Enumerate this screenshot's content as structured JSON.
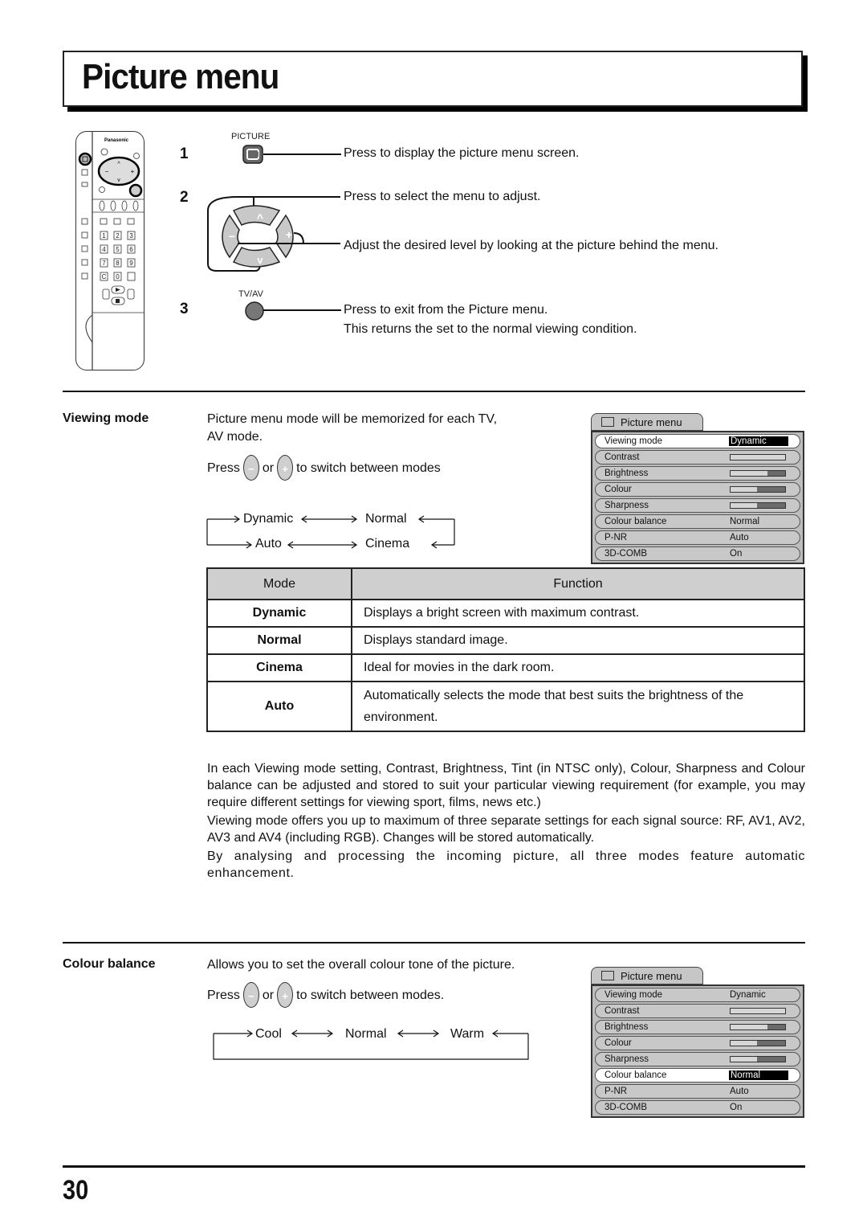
{
  "page": {
    "title": "Picture menu",
    "page_number": "30"
  },
  "remote": {
    "brand": "Panasonic",
    "numpad": [
      "1",
      "2",
      "3",
      "4",
      "5",
      "6",
      "7",
      "8",
      "9",
      "C",
      "0",
      "-/--"
    ]
  },
  "steps": [
    {
      "number": "1",
      "button_label": "PICTURE",
      "button_icon": "picture-button-icon",
      "lines": [
        "Press to display the picture menu screen."
      ]
    },
    {
      "number": "2",
      "button_label": "",
      "button_icon": "cursor-pad-icon",
      "lines": [
        "Press to select the menu to adjust.",
        "Adjust the desired level by looking at the picture behind the menu."
      ]
    },
    {
      "number": "3",
      "button_label": "TV/AV",
      "button_icon": "tv-av-button-icon",
      "lines": [
        "Press to exit from the Picture menu.",
        "This returns the set to the normal viewing condition."
      ]
    }
  ],
  "viewing_mode": {
    "label": "Viewing mode",
    "intro_line1": "Picture menu mode will be memorized for each TV,",
    "intro_line2": "AV mode.",
    "press": "Press",
    "or": "or",
    "switch_text": "to switch between modes",
    "minus_glyph": "−",
    "plus_glyph": "+",
    "cycle": {
      "top_left": "Dynamic",
      "top_right": "Normal",
      "bottom_left": "Auto",
      "bottom_right": "Cinema"
    },
    "table": {
      "headers": [
        "Mode",
        "Function"
      ],
      "rows": [
        {
          "mode": "Dynamic",
          "function": "Displays a bright screen with maximum contrast."
        },
        {
          "mode": "Normal",
          "function": "Displays standard image."
        },
        {
          "mode": "Cinema",
          "function": "Ideal for movies in the dark room."
        },
        {
          "mode": "Auto",
          "function": "Automatically selects the mode that best suits the brightness of the environment."
        }
      ]
    },
    "paragraphs": [
      "In each Viewing mode setting, Contrast, Brightness, Tint (in NTSC only), Colour, Sharpness and Colour balance can be adjusted and stored to suit your particular viewing requirement (for example, you may require different settings for viewing sport, films, news etc.)",
      "Viewing mode offers you up to maximum of three separate settings for each signal source: RF, AV1, AV2, AV3 and AV4 (including RGB). Changes will be stored automatically.",
      "By analysing and processing the incoming picture, all three modes feature automatic enhancement."
    ]
  },
  "colour_balance": {
    "label": "Colour balance",
    "intro": "Allows you to set the overall colour tone of the picture.",
    "press": "Press",
    "or": "or",
    "switch_text": "to switch between modes.",
    "cycle": [
      "Cool",
      "Normal",
      "Warm"
    ]
  },
  "osd_menus": [
    {
      "title": "Picture menu",
      "selected": "Viewing mode",
      "rows": [
        {
          "label": "Viewing mode",
          "value": "Dynamic"
        },
        {
          "label": "Contrast",
          "level": 1.0
        },
        {
          "label": "Brightness",
          "level": 0.67
        },
        {
          "label": "Colour",
          "level": 0.49
        },
        {
          "label": "Sharpness",
          "level": 0.49
        },
        {
          "label": "Colour balance",
          "value": "Normal"
        },
        {
          "label": "P-NR",
          "value": "Auto"
        },
        {
          "label": "3D-COMB",
          "value": "On"
        }
      ]
    },
    {
      "title": "Picture menu",
      "selected": "Colour balance",
      "rows": [
        {
          "label": "Viewing mode",
          "value": "Dynamic"
        },
        {
          "label": "Contrast",
          "level": 1.0
        },
        {
          "label": "Brightness",
          "level": 0.67
        },
        {
          "label": "Colour",
          "level": 0.49
        },
        {
          "label": "Sharpness",
          "level": 0.49
        },
        {
          "label": "Colour balance",
          "value": "Normal"
        },
        {
          "label": "P-NR",
          "value": "Auto"
        },
        {
          "label": "3D-COMB",
          "value": "On"
        }
      ]
    }
  ]
}
